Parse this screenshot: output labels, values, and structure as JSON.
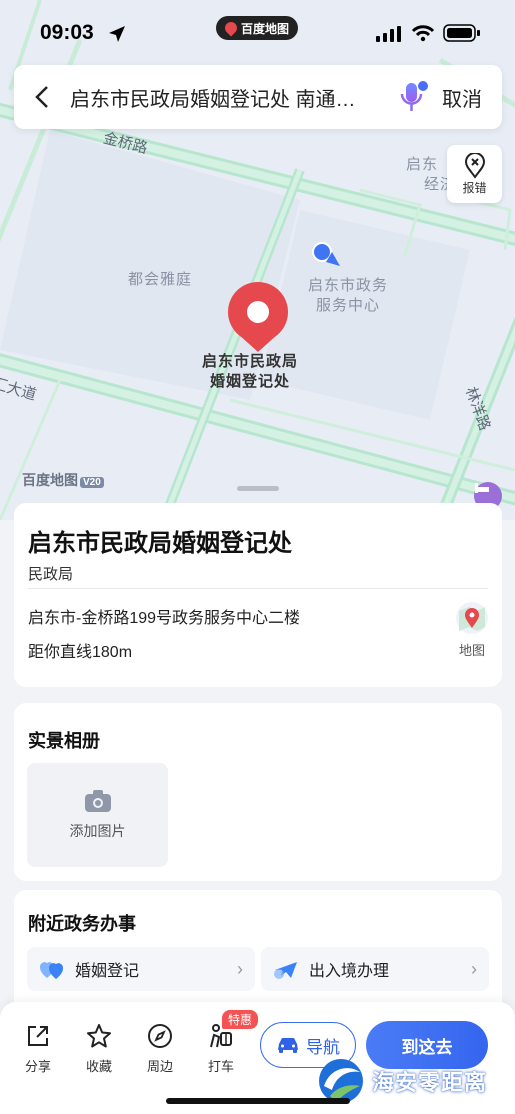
{
  "status_bar": {
    "time": "09:03",
    "app_badge": "百度地图"
  },
  "search": {
    "query": "启东市民政局婚姻登记处 南通…",
    "cancel_label": "取消"
  },
  "map": {
    "report_label": "报错",
    "roads": [
      "金桥路",
      "林洋路",
      "汇大道"
    ],
    "places": [
      "都会雅庭",
      "启东市政务\n服务中心",
      "启东市民政局\n婚姻登记处",
      "启东",
      "经济"
    ],
    "logo_text": "百度地图",
    "logo_version": "V20"
  },
  "poi": {
    "title": "启东市民政局婚姻登记处",
    "category": "民政局",
    "address": "启东市-金桥路199号政务服务中心二楼",
    "distance": "距你直线180m",
    "map_label": "地图"
  },
  "photos": {
    "section_title": "实景相册",
    "add_label": "添加图片"
  },
  "gov": {
    "section_title": "附近政务办事",
    "items": [
      {
        "label": "婚姻登记",
        "icon": "hearts-icon"
      },
      {
        "label": "出入境办理",
        "icon": "airplane-icon"
      }
    ]
  },
  "bottom_bar": {
    "tools": [
      {
        "label": "分享",
        "icon": "share-icon"
      },
      {
        "label": "收藏",
        "icon": "star-icon"
      },
      {
        "label": "周边",
        "icon": "compass-icon"
      },
      {
        "label": "打车",
        "icon": "taxi-icon"
      }
    ],
    "promo_tag": "特惠",
    "navigate_label": "导航",
    "go_label": "到这去"
  },
  "watermark": "海安零距离",
  "colors": {
    "accent": "#3565ee",
    "pin": "#e5484d",
    "road": "#b7e6cf"
  }
}
